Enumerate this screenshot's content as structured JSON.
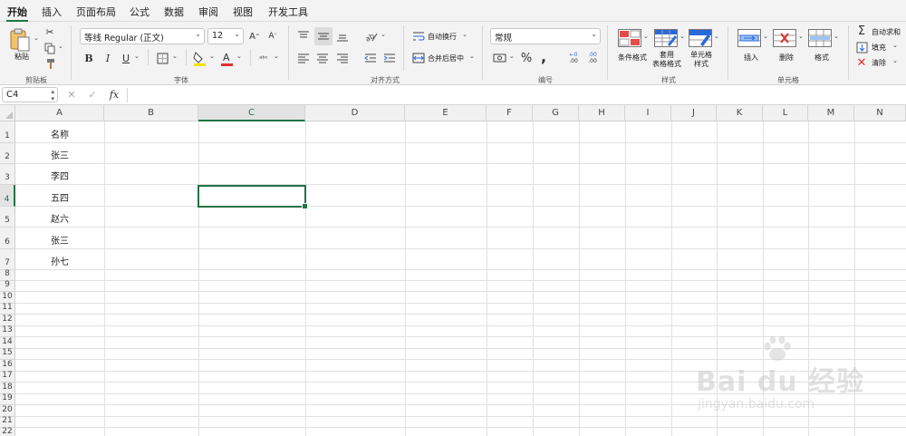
{
  "tabs": [
    "开始",
    "插入",
    "页面布局",
    "公式",
    "数据",
    "审阅",
    "视图",
    "开发工具"
  ],
  "active_tab": "开始",
  "ribbon": {
    "clipboard": {
      "label": "剪贴板",
      "paste": "粘贴"
    },
    "font": {
      "label": "字体",
      "font_name": "等线 Regular (正文)",
      "font_size": "12",
      "bold": "B",
      "italic": "I",
      "underline": "U"
    },
    "alignment": {
      "label": "对齐方式",
      "wrap_text": "自动换行",
      "merge_center": "合并后居中"
    },
    "number": {
      "label": "编号",
      "format": "常规",
      "percent": "%",
      "comma": ",",
      "inc_decimal": ".00",
      "dec_decimal": ".00"
    },
    "styles": {
      "label": "样式",
      "conditional": "条件格式",
      "table_format": "套用\n表格格式",
      "cell_styles": "单元格\n样式"
    },
    "cells": {
      "label": "单元格",
      "insert": "插入",
      "delete": "删除",
      "format": "格式"
    },
    "editing": {
      "autosum": "自动求和",
      "fill": "填充",
      "clear": "清除"
    }
  },
  "formula_bar": {
    "name_box": "C4",
    "fx": "fx",
    "value": ""
  },
  "grid": {
    "columns": [
      "A",
      "B",
      "C",
      "D",
      "E",
      "F",
      "G",
      "H",
      "I",
      "J",
      "K",
      "L",
      "M",
      "N"
    ],
    "rows": [
      "1",
      "2",
      "3",
      "4",
      "5",
      "6",
      "7",
      "8",
      "9",
      "10",
      "11",
      "12",
      "13",
      "14",
      "15",
      "16",
      "17",
      "18",
      "19",
      "20",
      "21",
      "22"
    ],
    "selected_cell": "C4",
    "column_a_values": [
      "名称",
      "张三",
      "李四",
      "五四",
      "赵六",
      "张三",
      "孙七"
    ]
  },
  "watermark": {
    "text": "Bai du 经验",
    "url": "jingyan.baidu.com"
  },
  "colors": {
    "accent": "#217346",
    "font_color_bar": "#e03030",
    "fill_color_bar": "#f5e300"
  }
}
